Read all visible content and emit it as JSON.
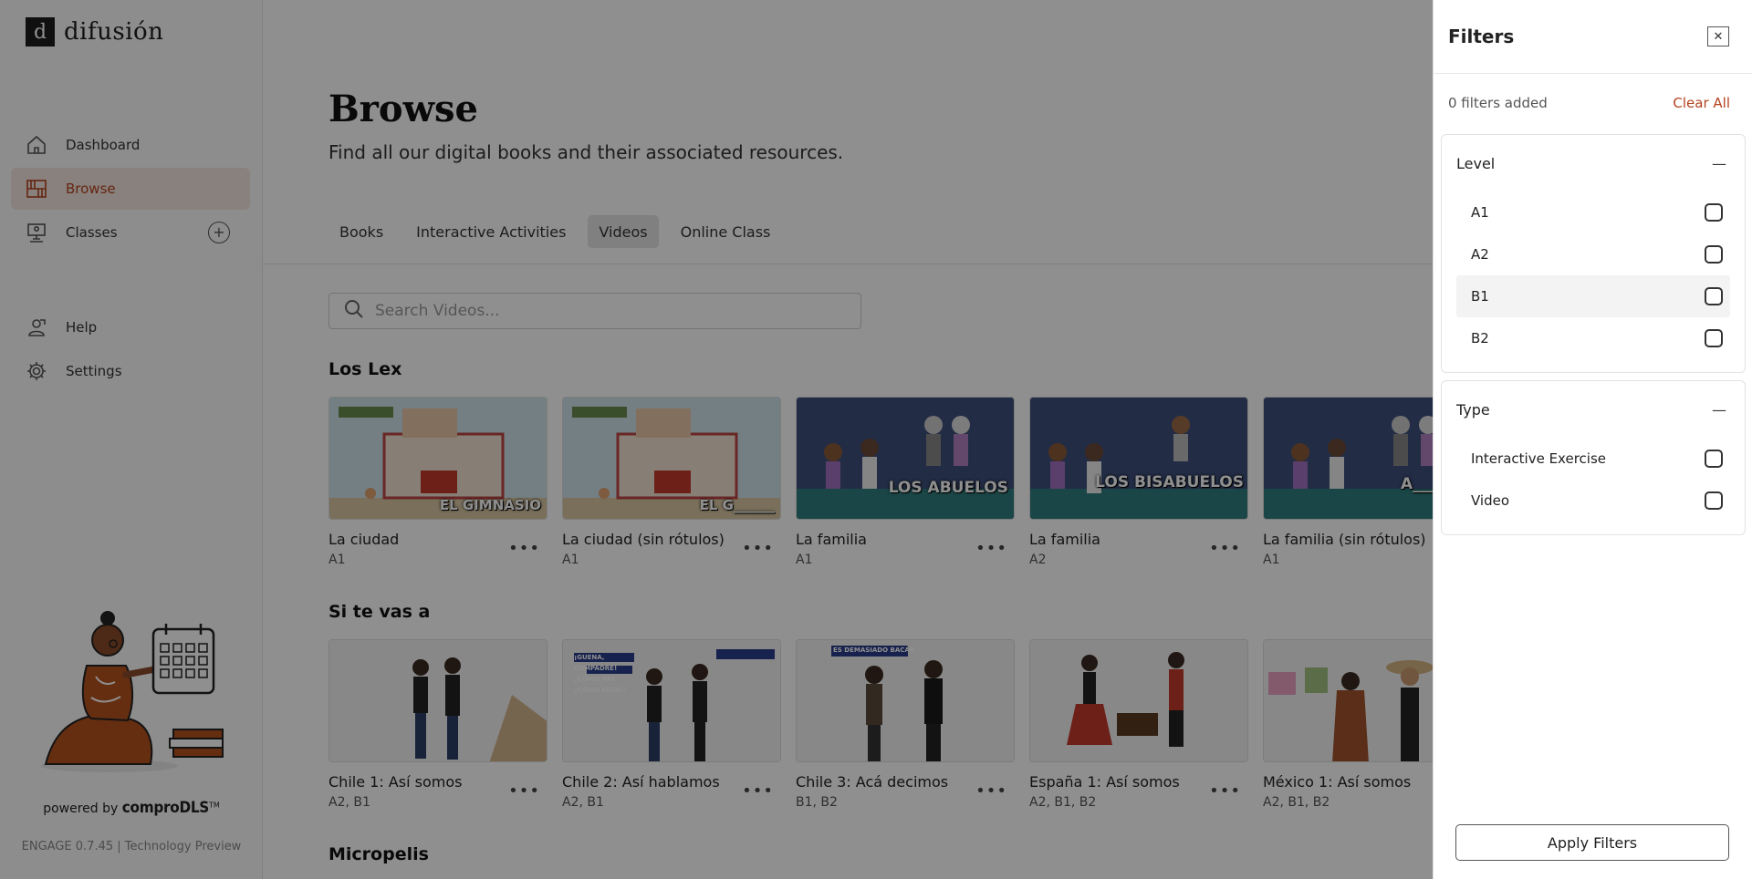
{
  "colors": {
    "accent": "#b4421e",
    "overlay": "rgba(0,0,0,0.44)"
  },
  "brand": {
    "name": "difusión",
    "mark": "d"
  },
  "sidebar": {
    "items": [
      {
        "label": "Dashboard",
        "icon": "home-icon"
      },
      {
        "label": "Browse",
        "icon": "bookshelf-icon",
        "active": true
      },
      {
        "label": "Classes",
        "icon": "classroom-icon",
        "action": "add-icon"
      },
      {
        "label": "Help",
        "icon": "help-person-icon"
      },
      {
        "label": "Settings",
        "icon": "gear-icon"
      }
    ],
    "powered_prefix": "powered by",
    "powered_brand": "comproDLS",
    "powered_tm": "TM",
    "version": "ENGAGE 0.7.45 | Technology Preview"
  },
  "main": {
    "title": "Browse",
    "subtitle": "Find all our digital books and their associated resources.",
    "tabs": [
      {
        "label": "Books"
      },
      {
        "label": "Interactive Activities"
      },
      {
        "label": "Videos",
        "active": true
      },
      {
        "label": "Online Class"
      }
    ],
    "search": {
      "placeholder": "Search Videos..."
    },
    "sections": [
      {
        "title": "Los Lex",
        "items": [
          {
            "title": "La ciudad",
            "level": "A1",
            "thumb_text": "EL GIMNASIO"
          },
          {
            "title": "La ciudad (sin rótulos)",
            "level": "A1",
            "thumb_text": "EL G______"
          },
          {
            "title": "La familia",
            "level": "A1",
            "thumb_text": "LOS ABUELOS"
          },
          {
            "title": "La familia",
            "level": "A2",
            "thumb_text": "LOS BISABUELOS"
          },
          {
            "title": "La familia (sin rótulos)",
            "level": "A1",
            "thumb_text": "A____"
          }
        ]
      },
      {
        "title": "Si te vas a",
        "items": [
          {
            "title": "Chile 1: Así somos",
            "level": "A2, B1"
          },
          {
            "title": "Chile 2: Así hablamos",
            "level": "A2, B1",
            "thumb_text": "¡GUENA, COMPADRE! ¿CÓMO VA? ¿CÓMO ESTÁI?"
          },
          {
            "title": "Chile 3: Acá decimos",
            "level": "B1, B2",
            "thumb_text": "ES DEMASIADO BACÁN"
          },
          {
            "title": "España 1: Así somos",
            "level": "A2, B1, B2"
          },
          {
            "title": "México 1: Así somos",
            "level": "A2, B1, B2"
          }
        ]
      },
      {
        "title": "Micropelis",
        "items": []
      }
    ]
  },
  "filters": {
    "title": "Filters",
    "count_text": "0 filters added",
    "clear_label": "Clear All",
    "groups": [
      {
        "label": "Level",
        "options": [
          "A1",
          "A2",
          "B1",
          "B2"
        ]
      },
      {
        "label": "Type",
        "options": [
          "Interactive Exercise",
          "Video"
        ]
      }
    ],
    "apply_label": "Apply Filters"
  }
}
